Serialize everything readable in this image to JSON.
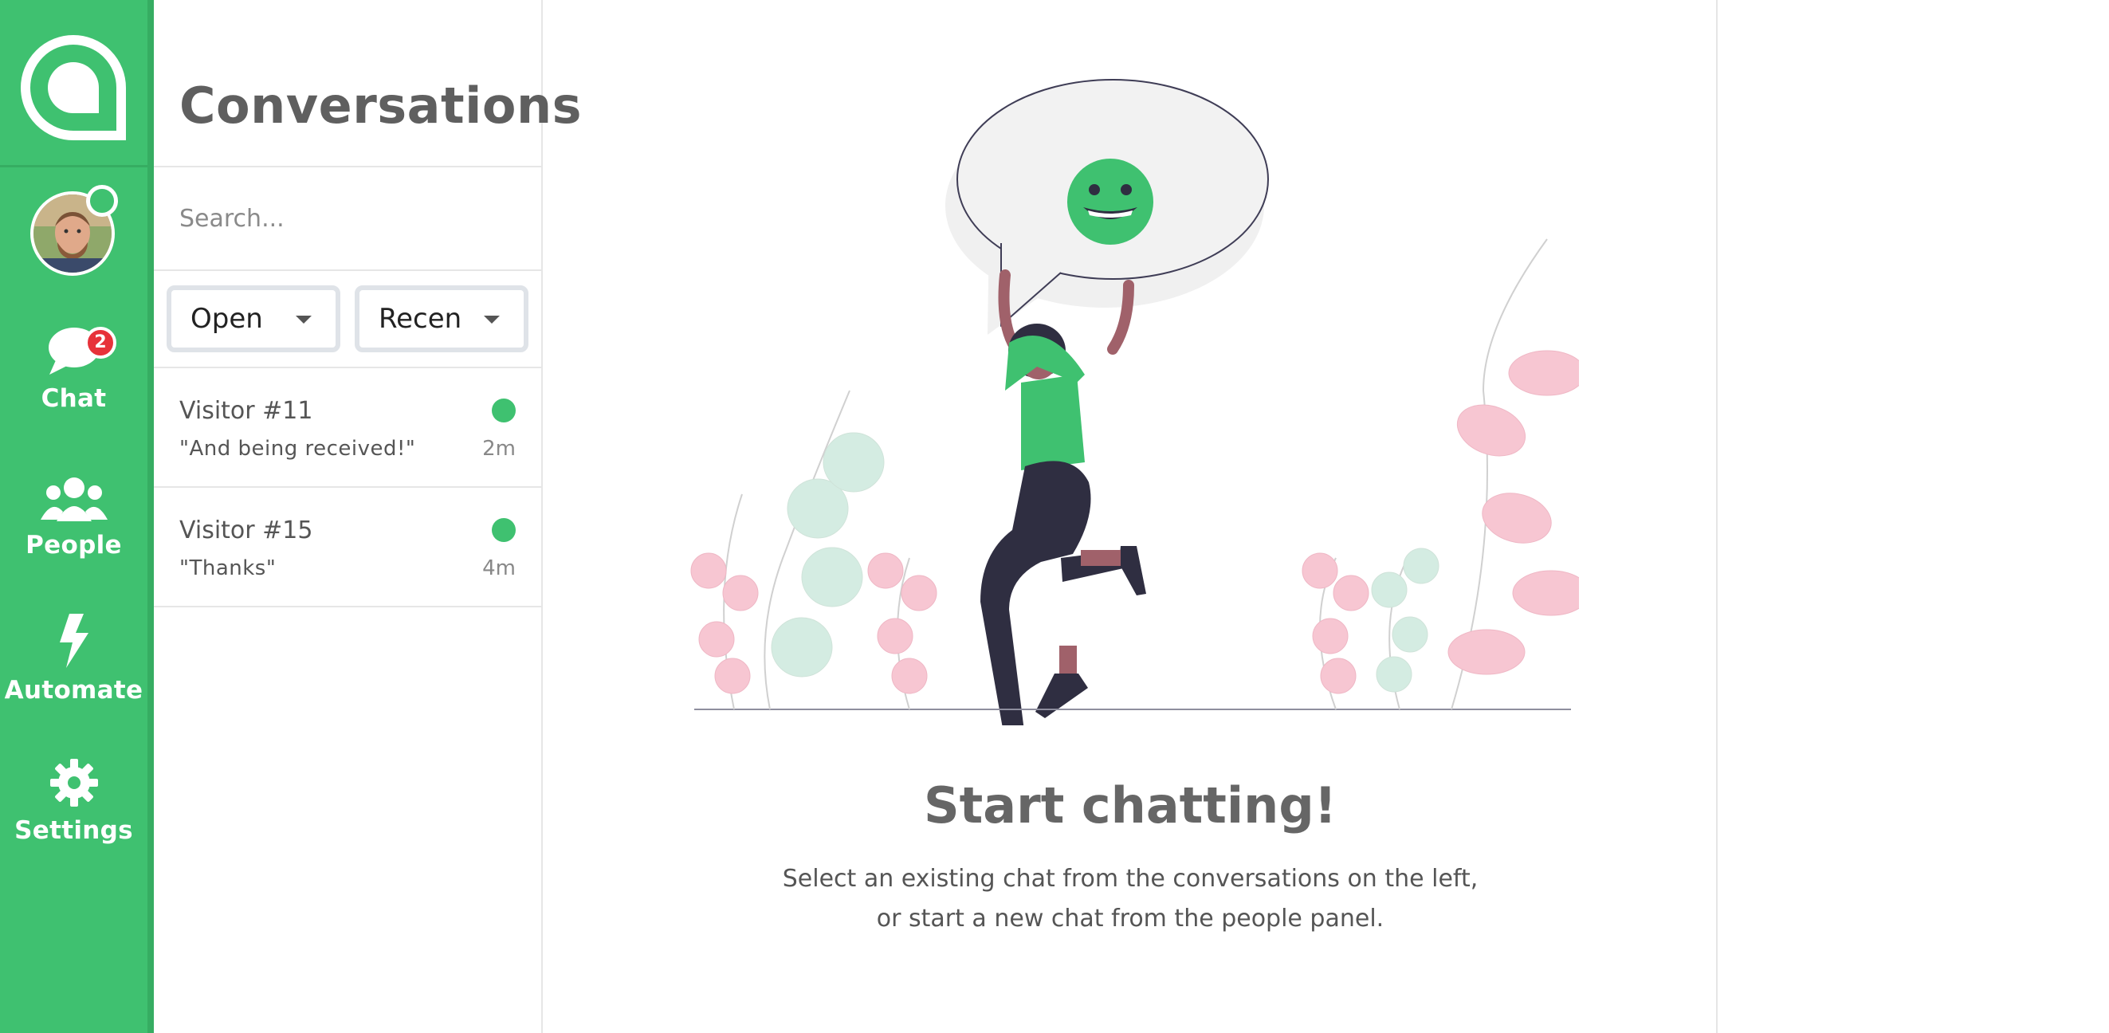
{
  "nav": {
    "items": [
      {
        "label": "Chat",
        "icon": "chat-icon",
        "badge": "2"
      },
      {
        "label": "People",
        "icon": "people-icon"
      },
      {
        "label": "Automate",
        "icon": "lightning-icon"
      },
      {
        "label": "Settings",
        "icon": "gear-icon"
      }
    ],
    "accent": "#3fc170",
    "badge_color": "#e7323a"
  },
  "conversations": {
    "title": "Conversations",
    "search_placeholder": "Search...",
    "filters": {
      "status": "Open",
      "sort": "Recen"
    },
    "items": [
      {
        "name": "Visitor #11",
        "message": "\"And being received!\"",
        "time": "2m",
        "online": true
      },
      {
        "name": "Visitor #15",
        "message": "\"Thanks\"",
        "time": "4m",
        "online": true
      }
    ]
  },
  "main": {
    "empty_title": "Start chatting!",
    "empty_subtitle_line1": "Select an existing chat from the conversations on the left,",
    "empty_subtitle_line2": "or start a new chat from the people panel."
  }
}
